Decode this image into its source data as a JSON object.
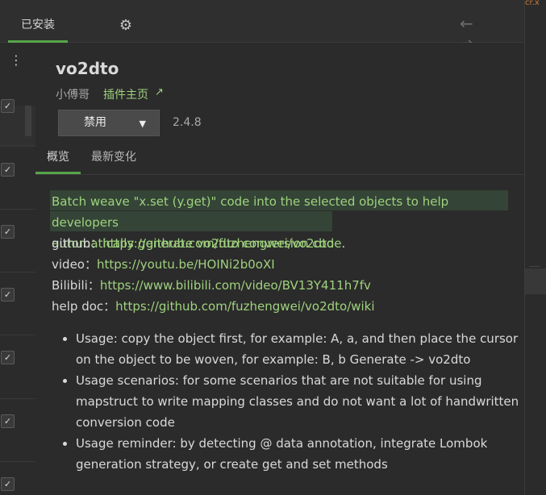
{
  "topbar": {
    "installed_tab": "已安装",
    "gear": "⚙",
    "arrows": "← →"
  },
  "right_strip": {
    "top_text": "cr.x"
  },
  "plugin": {
    "name": "vo2dto",
    "author": "小傅哥",
    "homepage_label": "插件主页",
    "homepage_arrow": "↗",
    "button_label": "禁用",
    "version": "2.4.8"
  },
  "tabs": {
    "overview": "概览",
    "changes": "最新变化"
  },
  "description": {
    "highlight_line_1": "Batch weave \"x.set (y.get)\" code into the selected objects to help developers",
    "highlight_line_2": "automatically generate vo2dto conversion code",
    "dot": "."
  },
  "links": [
    {
      "label": "github：",
      "url": "https://github.com/fuzhengwei/vo2dto"
    },
    {
      "label": "video：",
      "url": "https://youtu.be/HOINi2b0oXI"
    },
    {
      "label": "Bilibili：",
      "url": "https://www.bilibili.com/video/BV13Y411h7fv"
    },
    {
      "label": "help doc：",
      "url": "https://github.com/fuzhengwei/vo2dto/wiki"
    }
  ],
  "bullets": [
    "Usage: copy the object first, for example: A, a, and then place the cursor on the object to be woven, for example: B, b Generate -> vo2dto",
    "Usage scenarios: for some scenarios that are not suitable for using mapstruct to write mapping classes and do not want a lot of handwritten conversion code",
    "Usage reminder: by detecting @ data annotation, integrate Lombok generation strategy, or create get and set methods"
  ],
  "leftrail": {
    "menu": "⋮",
    "checks": [
      "✓",
      "✓",
      "✓",
      "✓",
      "✓",
      "✓",
      "✓"
    ]
  }
}
